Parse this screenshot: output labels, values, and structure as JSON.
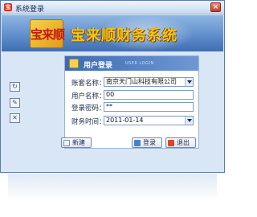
{
  "window": {
    "title": "系统登录"
  },
  "banner": {
    "logo_text": "宝来顺",
    "app_name": "宝来顺财务系统"
  },
  "login_panel": {
    "title": "用户登录",
    "subtitle": "USER LOGIN"
  },
  "form": {
    "account": {
      "label": "账套名称：",
      "value": "南京天门山科技有限公司"
    },
    "user": {
      "label": "用户名称：",
      "value": "00"
    },
    "password": {
      "label": "登录密码：",
      "value": "**"
    },
    "date": {
      "label": "财务时间：",
      "value": "2011-01-14"
    }
  },
  "buttons": {
    "new_label": "新建",
    "login_label": "登录",
    "exit_label": "退出"
  },
  "colors": {
    "accent": "#3d6bb3",
    "brand_gold": "#f4c51c",
    "close_red": "#c8392a"
  },
  "icons": {
    "side": [
      "refresh-icon",
      "edit-icon",
      "close-icon"
    ]
  }
}
